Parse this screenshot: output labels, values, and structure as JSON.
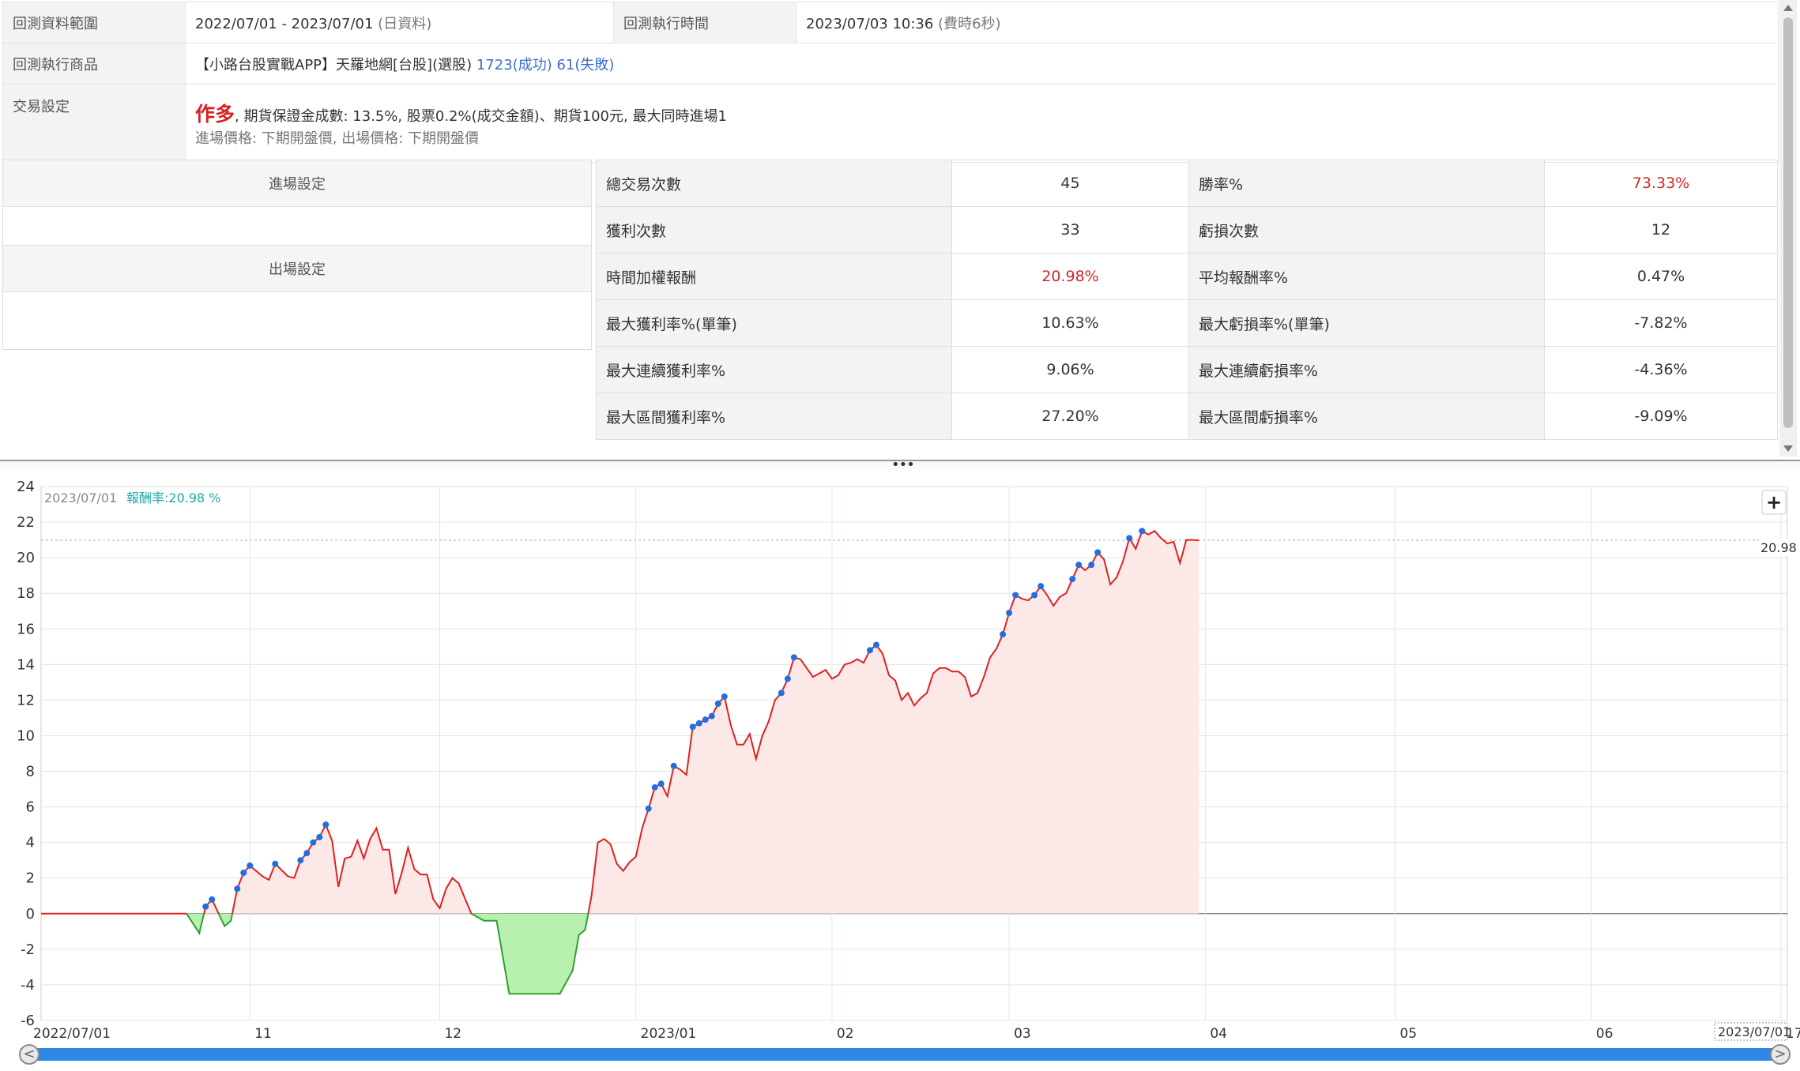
{
  "info": {
    "range_label": "回測資料範圍",
    "range_value": "2022/07/01 - 2023/07/01",
    "range_note": "(日資料)",
    "exec_time_label": "回測執行時間",
    "exec_time_value": "2023/07/03 10:36",
    "exec_time_note": "(費時6秒)",
    "product_label": "回測執行商品",
    "product_value": "【小路台股實戰APP】天羅地網[台股](選股)",
    "product_success": "1723(成功)",
    "product_fail": "61(失敗)",
    "trade_label": "交易設定",
    "trade_direction": "作多",
    "trade_detail": ", 期貨保證金成數: 13.5%, 股票0.2%(成交金額)、期貨100元, 最大同時進場1",
    "trade_price": "進場價格: 下期開盤價, 出場價格: 下期開盤價"
  },
  "settings": {
    "entry_label": "進場設定",
    "exit_label": "出場設定"
  },
  "stats": [
    {
      "k1": "總交易次數",
      "v1": "45",
      "k2": "勝率%",
      "v2": "73.33%",
      "v1_red": false,
      "v2_red": true
    },
    {
      "k1": "獲利次數",
      "v1": "33",
      "k2": "虧損次數",
      "v2": "12",
      "v1_red": false,
      "v2_red": false
    },
    {
      "k1": "時間加權報酬",
      "v1": "20.98%",
      "k2": "平均報酬率%",
      "v2": "0.47%",
      "v1_red": true,
      "v2_red": false
    },
    {
      "k1": "最大獲利率%(單筆)",
      "v1": "10.63%",
      "k2": "最大虧損率%(單筆)",
      "v2": "-7.82%",
      "v1_red": false,
      "v2_red": false
    },
    {
      "k1": "最大連續獲利率%",
      "v1": "9.06%",
      "k2": "最大連續虧損率%",
      "v2": "-4.36%",
      "v1_red": false,
      "v2_red": false
    },
    {
      "k1": "最大區間獲利率%",
      "v1": "27.20%",
      "k2": "最大區間虧損率%",
      "v2": "-9.09%",
      "v1_red": false,
      "v2_red": false
    }
  ],
  "chart_data": {
    "type": "area",
    "header_date": "2023/07/01",
    "header_label": "報酬率:",
    "header_value": "20.98",
    "header_unit": "%",
    "last_value_label": "20.98",
    "zoom_button": "+",
    "start_label": "2022/07/01",
    "end_label": "2023/07/01",
    "y_ticks": [
      24,
      22,
      20,
      18,
      16,
      14,
      12,
      10,
      8,
      6,
      4,
      2,
      0,
      -2,
      -4,
      -6
    ],
    "ylim": [
      -6,
      24
    ],
    "x_ticks": [
      {
        "day": 123,
        "label": "11"
      },
      {
        "day": 153,
        "label": "12"
      },
      {
        "day": 184,
        "label": "2023/01"
      },
      {
        "day": 215,
        "label": "02"
      },
      {
        "day": 243,
        "label": "03"
      },
      {
        "day": 274,
        "label": "04"
      },
      {
        "day": 304,
        "label": "05"
      },
      {
        "day": 335,
        "label": "06"
      },
      {
        "day": 365,
        "label": "17"
      }
    ],
    "x_range": [
      90,
      366
    ],
    "pos_line_color": "#e02020",
    "neg_line_color": "#30a030",
    "pos_fill_color": "#fde8e8",
    "neg_fill_color": "#b8f0b0",
    "marker_color": "#1f6fe0",
    "series": [
      [
        90,
        0
      ],
      [
        112,
        0
      ],
      [
        113,
        0
      ],
      [
        115,
        -1.1
      ],
      [
        116,
        0.4
      ],
      [
        117,
        0.8
      ],
      [
        119,
        -0.7
      ],
      [
        120,
        -0.4
      ],
      [
        121,
        1.4
      ],
      [
        122,
        2.3
      ],
      [
        123,
        2.7
      ],
      [
        125,
        2.1
      ],
      [
        126,
        1.9
      ],
      [
        127,
        2.8
      ],
      [
        129,
        2.1
      ],
      [
        130,
        2.0
      ],
      [
        131,
        3.0
      ],
      [
        132,
        3.4
      ],
      [
        133,
        4.0
      ],
      [
        134,
        4.3
      ],
      [
        135,
        5.0
      ],
      [
        136,
        4.1
      ],
      [
        137,
        1.5
      ],
      [
        138,
        3.1
      ],
      [
        139,
        3.2
      ],
      [
        140,
        4.1
      ],
      [
        141,
        3.1
      ],
      [
        142,
        4.2
      ],
      [
        143,
        4.8
      ],
      [
        144,
        3.6
      ],
      [
        145,
        3.6
      ],
      [
        146,
        1.1
      ],
      [
        147,
        2.3
      ],
      [
        148,
        3.7
      ],
      [
        149,
        2.5
      ],
      [
        150,
        2.2
      ],
      [
        151,
        2.2
      ],
      [
        152,
        0.8
      ],
      [
        153,
        0.3
      ],
      [
        154,
        1.4
      ],
      [
        155,
        2.0
      ],
      [
        156,
        1.7
      ],
      [
        158,
        0
      ],
      [
        160,
        -0.4
      ],
      [
        162,
        -0.4
      ],
      [
        164,
        -4.5
      ],
      [
        168,
        -4.5
      ],
      [
        172,
        -4.5
      ],
      [
        174,
        -3.2
      ],
      [
        175,
        -1.2
      ],
      [
        176,
        -0.9
      ],
      [
        177,
        1.0
      ],
      [
        178,
        4.0
      ],
      [
        179,
        4.2
      ],
      [
        180,
        3.9
      ],
      [
        181,
        2.8
      ],
      [
        182,
        2.4
      ],
      [
        183,
        2.9
      ],
      [
        184,
        3.2
      ],
      [
        185,
        4.8
      ],
      [
        186,
        5.9
      ],
      [
        187,
        7.1
      ],
      [
        188,
        7.3
      ],
      [
        189,
        6.6
      ],
      [
        190,
        8.3
      ],
      [
        191,
        8.1
      ],
      [
        192,
        7.8
      ],
      [
        193,
        10.5
      ],
      [
        194,
        10.7
      ],
      [
        195,
        10.9
      ],
      [
        196,
        11.1
      ],
      [
        197,
        11.8
      ],
      [
        198,
        12.2
      ],
      [
        199,
        10.6
      ],
      [
        200,
        9.5
      ],
      [
        201,
        9.5
      ],
      [
        202,
        10.1
      ],
      [
        203,
        8.7
      ],
      [
        204,
        10.0
      ],
      [
        205,
        10.8
      ],
      [
        206,
        12.0
      ],
      [
        207,
        12.4
      ],
      [
        208,
        13.2
      ],
      [
        209,
        14.4
      ],
      [
        210,
        14.3
      ],
      [
        211,
        13.8
      ],
      [
        212,
        13.3
      ],
      [
        213,
        13.5
      ],
      [
        214,
        13.7
      ],
      [
        215,
        13.2
      ],
      [
        216,
        13.4
      ],
      [
        217,
        14.0
      ],
      [
        218,
        14.1
      ],
      [
        219,
        14.3
      ],
      [
        220,
        14.1
      ],
      [
        221,
        14.8
      ],
      [
        222,
        15.1
      ],
      [
        223,
        14.6
      ],
      [
        224,
        13.4
      ],
      [
        225,
        13.1
      ],
      [
        226,
        12.0
      ],
      [
        227,
        12.4
      ],
      [
        228,
        11.7
      ],
      [
        229,
        12.1
      ],
      [
        230,
        12.4
      ],
      [
        231,
        13.5
      ],
      [
        232,
        13.8
      ],
      [
        233,
        13.8
      ],
      [
        234,
        13.6
      ],
      [
        235,
        13.6
      ],
      [
        236,
        13.3
      ],
      [
        237,
        12.2
      ],
      [
        238,
        12.4
      ],
      [
        239,
        13.3
      ],
      [
        240,
        14.4
      ],
      [
        241,
        14.9
      ],
      [
        242,
        15.7
      ],
      [
        243,
        16.9
      ],
      [
        244,
        17.9
      ],
      [
        245,
        17.7
      ],
      [
        246,
        17.6
      ],
      [
        247,
        17.9
      ],
      [
        248,
        18.4
      ],
      [
        249,
        17.9
      ],
      [
        250,
        17.3
      ],
      [
        251,
        17.8
      ],
      [
        252,
        18.0
      ],
      [
        253,
        18.8
      ],
      [
        254,
        19.6
      ],
      [
        255,
        19.3
      ],
      [
        256,
        19.6
      ],
      [
        257,
        20.3
      ],
      [
        258,
        19.9
      ],
      [
        259,
        18.5
      ],
      [
        260,
        18.9
      ],
      [
        261,
        19.8
      ],
      [
        262,
        21.1
      ],
      [
        263,
        20.5
      ],
      [
        264,
        21.5
      ],
      [
        265,
        21.3
      ],
      [
        266,
        21.5
      ],
      [
        267,
        21.1
      ],
      [
        268,
        20.8
      ],
      [
        269,
        20.9
      ],
      [
        270,
        19.7
      ],
      [
        271,
        21.0
      ],
      [
        272,
        21.0
      ],
      [
        273,
        20.98
      ]
    ],
    "markers": [
      [
        116,
        0.4
      ],
      [
        117,
        0.8
      ],
      [
        121,
        1.4
      ],
      [
        122,
        2.3
      ],
      [
        123,
        2.7
      ],
      [
        127,
        2.8
      ],
      [
        131,
        3.0
      ],
      [
        132,
        3.4
      ],
      [
        133,
        4.0
      ],
      [
        134,
        4.3
      ],
      [
        135,
        5.0
      ],
      [
        186,
        5.9
      ],
      [
        187,
        7.1
      ],
      [
        188,
        7.3
      ],
      [
        190,
        8.3
      ],
      [
        193,
        10.5
      ],
      [
        194,
        10.7
      ],
      [
        195,
        10.9
      ],
      [
        196,
        11.1
      ],
      [
        197,
        11.8
      ],
      [
        198,
        12.2
      ],
      [
        207,
        12.4
      ],
      [
        208,
        13.2
      ],
      [
        209,
        14.4
      ],
      [
        221,
        14.8
      ],
      [
        222,
        15.1
      ],
      [
        242,
        15.7
      ],
      [
        243,
        16.9
      ],
      [
        244,
        17.9
      ],
      [
        247,
        17.9
      ],
      [
        248,
        18.4
      ],
      [
        253,
        18.8
      ],
      [
        254,
        19.6
      ],
      [
        256,
        19.6
      ],
      [
        257,
        20.3
      ],
      [
        262,
        21.1
      ],
      [
        264,
        21.5
      ]
    ]
  }
}
